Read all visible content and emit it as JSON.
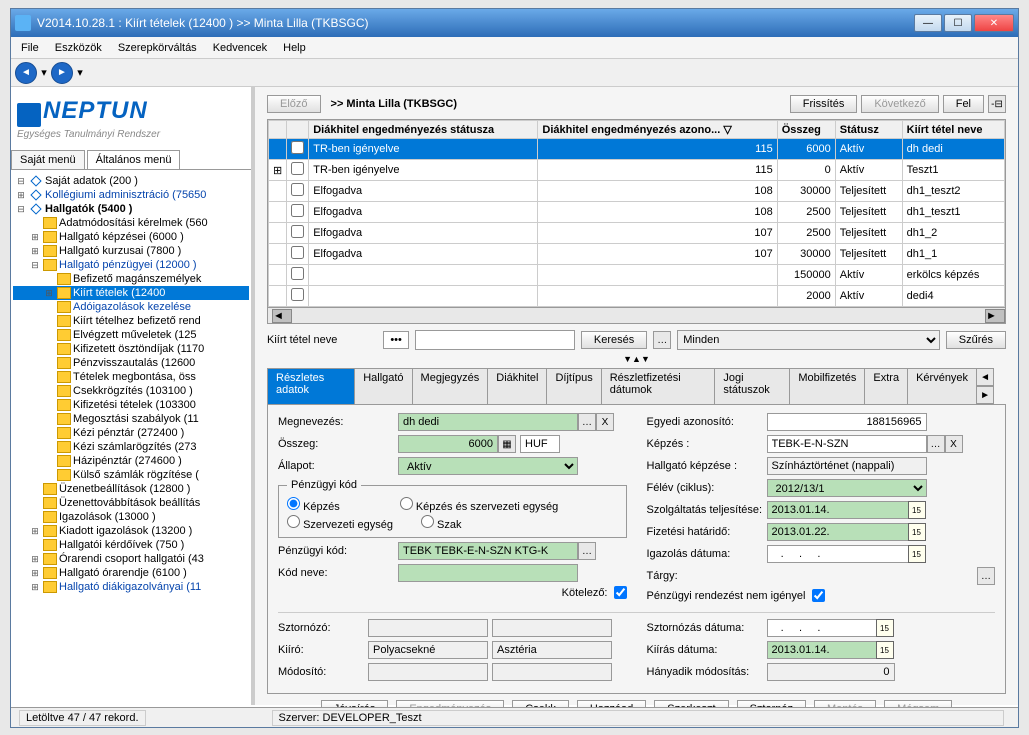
{
  "window_title": "V2014.10.28.1 : Kiírt tételek (12400  )  >> Minta Lilla (TKBSGC)",
  "menubar": [
    "File",
    "Eszközök",
    "Szerepkörváltás",
    "Kedvencek",
    "Help"
  ],
  "logo": "NEPTUN",
  "tagline": "Egységes Tanulmányi Rendszer",
  "side_tabs": {
    "own": "Saját menü",
    "general": "Általános menü"
  },
  "tree": [
    {
      "ind": 0,
      "exp": "⊟",
      "ico": "diam",
      "text": "Saját adatok (200  )",
      "link": 0
    },
    {
      "ind": 0,
      "exp": "⊞",
      "ico": "diam",
      "text": "Kollégiumi adminisztráció (75650",
      "link": 1
    },
    {
      "ind": 0,
      "exp": "⊟",
      "ico": "diam",
      "text": "Hallgatók (5400  )",
      "link": 0,
      "bold": 1
    },
    {
      "ind": 1,
      "exp": "",
      "ico": "y",
      "text": "Adatmódosítási kérelmek (560"
    },
    {
      "ind": 1,
      "exp": "⊞",
      "ico": "y",
      "text": "Hallgató képzései (6000  )"
    },
    {
      "ind": 1,
      "exp": "⊞",
      "ico": "y",
      "text": "Hallgató kurzusai (7800  )"
    },
    {
      "ind": 1,
      "exp": "⊟",
      "ico": "y",
      "text": "Hallgató pénzügyei (12000  )",
      "link": 1
    },
    {
      "ind": 2,
      "exp": "",
      "ico": "y",
      "text": "Befizető magánszemélyek"
    },
    {
      "ind": 2,
      "exp": "⊞",
      "ico": "y",
      "text": "Kiírt tételek (12400",
      "link": 1,
      "sel": 1
    },
    {
      "ind": 2,
      "exp": "",
      "ico": "y",
      "text": "Adóigazolások kezelése",
      "link": 1
    },
    {
      "ind": 2,
      "exp": "",
      "ico": "y",
      "text": "Kiírt tételhez befizető rend"
    },
    {
      "ind": 2,
      "exp": "",
      "ico": "y",
      "text": "Elvégzett műveletek (125"
    },
    {
      "ind": 2,
      "exp": "",
      "ico": "y",
      "text": "Kifizetett ösztöndíjak (1170"
    },
    {
      "ind": 2,
      "exp": "",
      "ico": "y",
      "text": "Pénzvisszautalás (12600"
    },
    {
      "ind": 2,
      "exp": "",
      "ico": "y",
      "text": "Tételek megbontása, öss"
    },
    {
      "ind": 2,
      "exp": "",
      "ico": "y",
      "text": "Csekkrögzítés (103100  )"
    },
    {
      "ind": 2,
      "exp": "",
      "ico": "y",
      "text": "Kifizetési tételek (103300"
    },
    {
      "ind": 2,
      "exp": "",
      "ico": "y",
      "text": "Megosztási szabályok (11"
    },
    {
      "ind": 2,
      "exp": "",
      "ico": "y",
      "text": "Kézi pénztár (272400  )"
    },
    {
      "ind": 2,
      "exp": "",
      "ico": "y",
      "text": "Kézi számlarögzítés (273"
    },
    {
      "ind": 2,
      "exp": "",
      "ico": "y",
      "text": "Házipénztár (274600  )"
    },
    {
      "ind": 2,
      "exp": "",
      "ico": "y",
      "text": "Külső számlák rögzítése ("
    },
    {
      "ind": 1,
      "exp": "",
      "ico": "y",
      "text": "Üzenetbeállítások (12800  )"
    },
    {
      "ind": 1,
      "exp": "",
      "ico": "y",
      "text": "Üzenettovábbítások beállítás"
    },
    {
      "ind": 1,
      "exp": "",
      "ico": "y",
      "text": "Igazolások (13000  )"
    },
    {
      "ind": 1,
      "exp": "⊞",
      "ico": "y",
      "text": "Kiadott igazolások (13200  )"
    },
    {
      "ind": 1,
      "exp": "",
      "ico": "y",
      "text": "Hallgatói kérdőívek (750  )"
    },
    {
      "ind": 1,
      "exp": "⊞",
      "ico": "y",
      "text": "Órarendi csoport hallgatói (43"
    },
    {
      "ind": 1,
      "exp": "⊞",
      "ico": "y",
      "text": "Hallgató órarendje (6100  )"
    },
    {
      "ind": 1,
      "exp": "⊞",
      "ico": "y",
      "text": "Hallgató diákigazolványai (11",
      "link": 1
    }
  ],
  "content_title": ">> Minta Lilla (TKBSGC)",
  "topbtns": {
    "prev": "Előző",
    "refresh": "Frissítés",
    "next": "Következő",
    "up": "Fel"
  },
  "grid": {
    "headers": [
      "",
      "",
      "Diákhitel engedményezés státusza",
      "Diákhitel engedményezés azono...   ▽",
      "Összeg",
      "Státusz",
      "Kiírt tétel neve"
    ],
    "rows": [
      {
        "sel": 1,
        "c": [
          "",
          "",
          "TR-ben igényelve",
          "115",
          "6000",
          "Aktív",
          "dh dedi"
        ]
      },
      {
        "c": [
          "⊞",
          "",
          "TR-ben igényelve",
          "115",
          "0",
          "Aktív",
          "Teszt1"
        ]
      },
      {
        "c": [
          "",
          "",
          "Elfogadva",
          "108",
          "30000",
          "Teljesített",
          "dh1_teszt2"
        ]
      },
      {
        "c": [
          "",
          "",
          "Elfogadva",
          "108",
          "2500",
          "Teljesített",
          "dh1_teszt1"
        ]
      },
      {
        "c": [
          "",
          "",
          "Elfogadva",
          "107",
          "2500",
          "Teljesített",
          "dh1_2"
        ]
      },
      {
        "c": [
          "",
          "",
          "Elfogadva",
          "107",
          "30000",
          "Teljesített",
          "dh1_1"
        ]
      },
      {
        "c": [
          "",
          "",
          "",
          "",
          "150000",
          "Aktív",
          "erkölcs képzés"
        ]
      },
      {
        "c": [
          "",
          "",
          "",
          "",
          "2000",
          "Aktív",
          "dedi4"
        ]
      }
    ]
  },
  "search": {
    "label": "Kiírt tétel neve",
    "dots": "•••",
    "btn": "Keresés",
    "filter": "Minden",
    "filterbtn": "Szűrés"
  },
  "tabs": [
    "Részletes adatok",
    "Hallgató",
    "Megjegyzés",
    "Diákhitel",
    "Díjtípus",
    "Részletfizetési dátumok",
    "Jogi státuszok",
    "Mobilfizetés",
    "Extra",
    "Kérvények"
  ],
  "form": {
    "megnevezes": {
      "label": "Megnevezés:",
      "value": "dh dedi"
    },
    "osszeg": {
      "label": "Összeg:",
      "value": "6000",
      "currency": "HUF"
    },
    "allapot": {
      "label": "Állapot:",
      "value": "Aktív"
    },
    "penzugyi_kod_legend": "Pénzügyi kód",
    "radios": {
      "kepzes": "Képzés",
      "szerv": "Szervezeti egység",
      "kepzes_szerv": "Képzés és szervezeti egység",
      "szak": "Szak"
    },
    "penzugyi_kod": {
      "label": "Pénzügyi kód:",
      "value": "TEBK TEBK-E-N-SZN KTG-K"
    },
    "kod_neve": {
      "label": "Kód neve:",
      "value": ""
    },
    "kotelezo": {
      "label": "Kötelező:",
      "checked": true
    },
    "egyedi": {
      "label": "Egyedi azonosító:",
      "value": "188156965"
    },
    "kepzes_r": {
      "label": "Képzés :",
      "value": "TEBK-E-N-SZN"
    },
    "hallg_kepz": {
      "label": "Hallgató képzése :",
      "value": "Színháztörténet (nappali)"
    },
    "felev": {
      "label": "Félév (ciklus):",
      "value": "2012/13/1"
    },
    "szolg": {
      "label": "Szolgáltatás teljesítése:",
      "value": "2013.01.14."
    },
    "hatarido": {
      "label": "Fizetési határidő:",
      "value": "2013.01.22."
    },
    "igazolas": {
      "label": "Igazolás dátuma:",
      "value": "   .     .     ."
    },
    "targy": {
      "label": "Tárgy:",
      "value": ""
    },
    "penzrend": {
      "label": "Pénzügyi rendezést nem igényel",
      "checked": true
    },
    "sztornozo": {
      "label": "Sztornózó:",
      "value": ""
    },
    "kiiro": {
      "label": "Kiíró:",
      "value1": "Polyacsekné",
      "value2": "Asztéria"
    },
    "modosito": {
      "label": "Módosító:",
      "value": ""
    },
    "sztorn_dat": {
      "label": "Sztornózás dátuma:",
      "value": "   .     .     ."
    },
    "kiiras_dat": {
      "label": "Kiírás dátuma:",
      "value": "2013.01.14."
    },
    "hanyad": {
      "label": "Hányadik módosítás:",
      "value": "0"
    }
  },
  "bottombtns": [
    "Jóvaírás",
    "Engedményezés",
    "Csekk",
    "Hozzáad",
    "Szerkeszt",
    "Sztornóz",
    "Mentés",
    "Mégsem"
  ],
  "status": {
    "left": "Letöltve 47 / 47 rekord.",
    "right": "Szerver: DEVELOPER_Teszt"
  }
}
